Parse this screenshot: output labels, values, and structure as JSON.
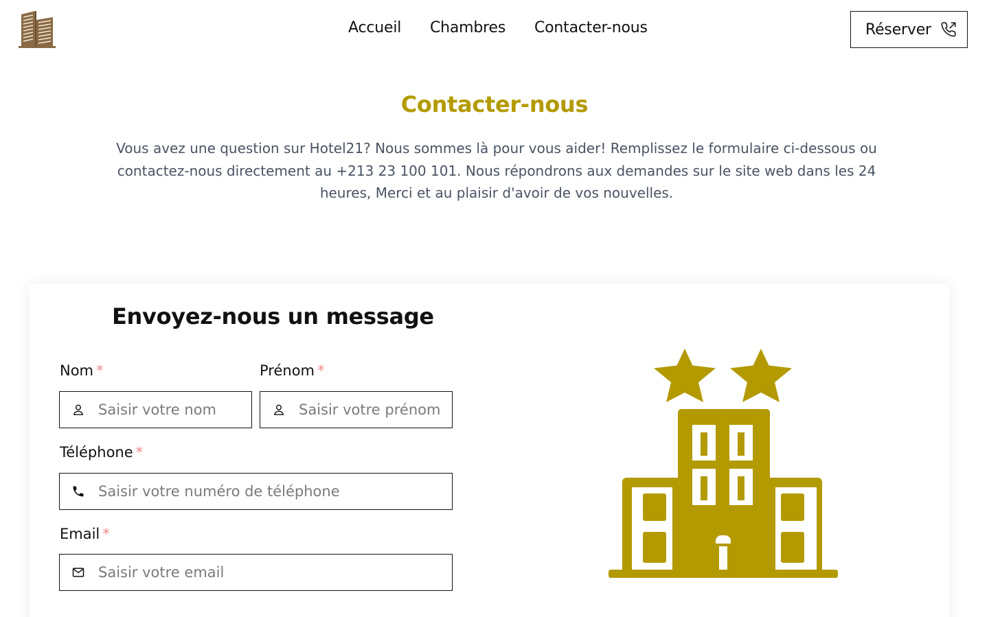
{
  "header": {
    "logo_icon": "building-logo-icon",
    "nav": [
      "Accueil",
      "Chambres",
      "Contacter-nous"
    ],
    "reserve_label": "Réserver",
    "reserve_icon": "phone-outgoing-icon"
  },
  "intro": {
    "title": "Contacter-nous",
    "text": "Vous avez une question sur Hotel21? Nous sommes là pour vous aider! Remplissez le formulaire ci-dessous ou contactez-nous directement au +213 23 100 101. Nous répondrons aux demandes sur le site web dans les 24 heures, Merci et au plaisir d'avoir de vos nouvelles."
  },
  "form": {
    "title": "Envoyez-nous un message",
    "required_mark": "*",
    "fields": {
      "nom": {
        "label": "Nom",
        "placeholder": "Saisir votre nom",
        "value": "",
        "icon": "user-icon"
      },
      "prenom": {
        "label": "Prénom",
        "placeholder": "Saisir votre prénom",
        "value": "",
        "icon": "user-icon"
      },
      "telephone": {
        "label": "Téléphone",
        "placeholder": "Saisir votre numéro de téléphone",
        "value": "",
        "icon": "phone-icon"
      },
      "email": {
        "label": "Email",
        "placeholder": "Saisir votre email",
        "value": "",
        "icon": "mail-icon"
      }
    }
  },
  "illustration": {
    "icon": "hotel-two-stars-icon"
  },
  "colors": {
    "accent": "#b39a00",
    "logo": "#8a6a45",
    "text_muted": "#4a5363",
    "required": "#f08a8a"
  }
}
